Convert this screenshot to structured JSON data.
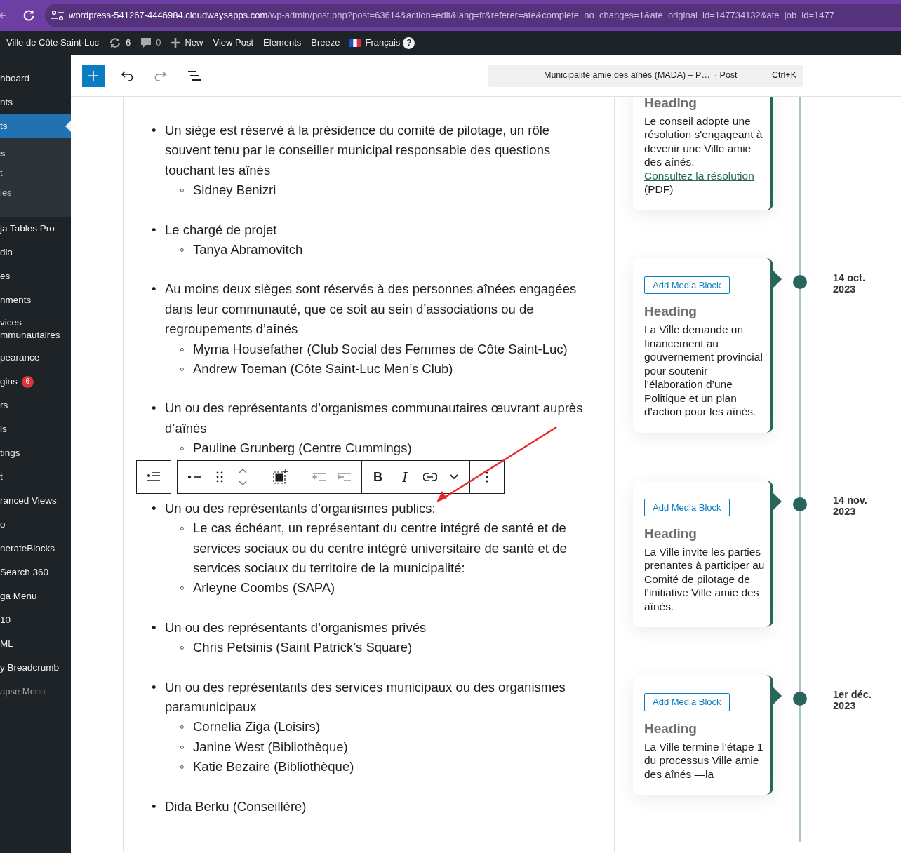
{
  "browser": {
    "url_host": "wordpress-541267-4446984.cloudwaysapps.com",
    "url_path": "/wp-admin/post.php?post=63614&action=edit&lang=fr&referer=ate&complete_no_changes=1&ate_original_id=147734132&ate_job_id=1477"
  },
  "admin_bar": {
    "items": [
      {
        "kind": "site",
        "label": "Ville de Côte Saint-Luc"
      },
      {
        "kind": "updates",
        "label": "6"
      },
      {
        "kind": "comments",
        "label": "0"
      },
      {
        "kind": "new",
        "label": "New"
      },
      {
        "kind": "link",
        "label": "View Post"
      },
      {
        "kind": "link",
        "label": "Elements"
      },
      {
        "kind": "link",
        "label": "Breeze"
      },
      {
        "kind": "language",
        "label": "Français",
        "help": "?"
      }
    ]
  },
  "sidebar": {
    "items": [
      {
        "kind": "item",
        "label": "hboard",
        "selected": false
      },
      {
        "kind": "item",
        "label": "nts",
        "selected": false
      },
      {
        "kind": "item",
        "label": "ts",
        "selected": true,
        "submenu": [
          {
            "label": "s",
            "selected": true
          },
          {
            "label": "t",
            "selected": false
          },
          {
            "label": "ies",
            "selected": false
          }
        ]
      },
      {
        "kind": "item",
        "label": "ja Tables Pro",
        "selected": false
      },
      {
        "kind": "item",
        "label": "dia",
        "selected": false
      },
      {
        "kind": "item",
        "label": "es",
        "selected": false
      },
      {
        "kind": "item",
        "label": "nments",
        "selected": false
      },
      {
        "kind": "item",
        "label": "vices mmunautaires",
        "selected": false
      },
      {
        "kind": "item",
        "label": "pearance",
        "selected": false
      },
      {
        "kind": "item",
        "label": "gins",
        "selected": false,
        "badge": "6"
      },
      {
        "kind": "item",
        "label": "rs",
        "selected": false
      },
      {
        "kind": "item",
        "label": "ls",
        "selected": false
      },
      {
        "kind": "item",
        "label": "tings",
        "selected": false
      },
      {
        "kind": "item",
        "label": "t",
        "selected": false
      },
      {
        "kind": "item",
        "label": "ranced Views",
        "selected": false
      },
      {
        "kind": "item",
        "label": "o",
        "selected": false
      },
      {
        "kind": "item",
        "label": "nerateBlocks",
        "selected": false
      },
      {
        "kind": "item",
        "label": "Search 360",
        "selected": false
      },
      {
        "kind": "item",
        "label": "ga Menu",
        "selected": false
      },
      {
        "kind": "item",
        "label": "10",
        "selected": false
      },
      {
        "kind": "item",
        "label": "ML",
        "selected": false
      },
      {
        "kind": "item",
        "label": "y Breadcrumb",
        "selected": false
      },
      {
        "kind": "collapse",
        "label": "apse Menu",
        "selected": false
      }
    ]
  },
  "editor_header": {
    "tools": [
      {
        "kind": "inserter",
        "disabled": false
      },
      {
        "kind": "undo",
        "disabled": false
      },
      {
        "kind": "redo",
        "disabled": true
      },
      {
        "kind": "list_view",
        "disabled": false
      }
    ],
    "command_bar": {
      "title": "Municipalité amie des aînés (MADA) – P…",
      "type": "· Post",
      "shortcut": "Ctrl+K"
    }
  },
  "content": {
    "list": [
      {
        "marker": "•",
        "text": "Un siège est réservé à la présidence du comité de pilotage, un rôle souvent tenu par le conseiller municipal responsable des questions touchant les aînés",
        "children": [
          {
            "marker": "◦",
            "text": "Sidney Benizri"
          }
        ]
      },
      {
        "marker": "•",
        "text": "Le chargé de projet",
        "children": [
          {
            "marker": "◦",
            "text": "Tanya Abramovitch"
          }
        ]
      },
      {
        "marker": "•",
        "text": "Au moins deux sièges sont réservés à des personnes aînées engagées dans leur communauté, que ce soit au sein d’associations ou de regroupements d’aînés",
        "children": [
          {
            "marker": "◦",
            "text": "Myrna Housefather (Club Social des Femmes de Côte Saint-Luc)"
          },
          {
            "marker": "◦",
            "text": "Andrew Toeman (Côte Saint-Luc Men’s Club)"
          }
        ]
      },
      {
        "marker": "•",
        "text": "Un ou des représentants d’organismes communautaires œuvrant auprès d’aînés",
        "children": [
          {
            "marker": "◦",
            "text": "Pauline Grunberg (Centre Cummings)"
          }
        ]
      },
      {
        "marker": "•",
        "text": "Un ou des représentants d’organismes publics:",
        "children": [
          {
            "marker": "◦",
            "text": "Le cas échéant, un représentant du centre intégré de santé et de services sociaux ou du centre intégré universitaire de santé et de services sociaux du territoire de la municipalité:"
          },
          {
            "marker": "◦",
            "text": "Arleyne Coombs (SAPA)"
          }
        ]
      },
      {
        "marker": "•",
        "text": "Un ou des représentants d’organismes privés",
        "children": [
          {
            "marker": "◦",
            "text": "Chris Petsinis (Saint Patrick’s Square)"
          }
        ]
      },
      {
        "marker": "•",
        "text": "Un ou des représentants des services municipaux ou des organismes paramunicipaux",
        "children": [
          {
            "marker": "◦",
            "text": "Cornelia Ziga (Loisirs)"
          },
          {
            "marker": "◦",
            "text": "Janine West (Bibliothèque)"
          },
          {
            "marker": "◦",
            "text": "Katie Bezaire (Bibliothèque)"
          }
        ]
      },
      {
        "marker": "•",
        "text": "Dida Berku (Conseillère)"
      }
    ],
    "block_toolbar": {
      "groups": [
        [
          {
            "kind": "list_style",
            "disabled": false
          }
        ],
        [
          {
            "kind": "bullet",
            "disabled": false
          },
          {
            "kind": "drag",
            "disabled": false
          },
          {
            "kind": "move",
            "disabled": false
          }
        ],
        [
          {
            "kind": "select_parent",
            "disabled": false
          }
        ],
        [
          {
            "kind": "outdent",
            "disabled": true
          },
          {
            "kind": "indent",
            "disabled": true
          }
        ],
        [
          {
            "kind": "bold",
            "label": "B",
            "disabled": false
          },
          {
            "kind": "italic",
            "label": "I",
            "disabled": false
          },
          {
            "kind": "link",
            "disabled": false
          },
          {
            "kind": "more",
            "disabled": false
          }
        ],
        [
          {
            "kind": "options",
            "disabled": false
          }
        ]
      ]
    }
  },
  "timeline": {
    "events": [
      {
        "heading": "Heading",
        "text": "Le conseil adopte une résolution s'engageant à devenir une Ville amie des aînés.",
        "link": "Consultez la résolution",
        "after": "(PDF)"
      },
      {
        "button": "Add Media Block",
        "heading": "Heading",
        "text": "La Ville demande un financement au gouvernement provincial pour soutenir l’élaboration d’une Politique et un plan d’action pour les aînés.",
        "date": "14 oct. 2023"
      },
      {
        "button": "Add Media Block",
        "heading": "Heading",
        "text": "La Ville invite les parties prenantes à participer au Comité de pilotage de l’initiative Ville amie des aînés.",
        "date": "14 nov. 2023"
      },
      {
        "button": "Add Media Block",
        "heading": "Heading",
        "text": "La Ville termine l’étape 1 du processus Ville amie des aînés —la",
        "date": "1er déc. 2023"
      }
    ]
  }
}
